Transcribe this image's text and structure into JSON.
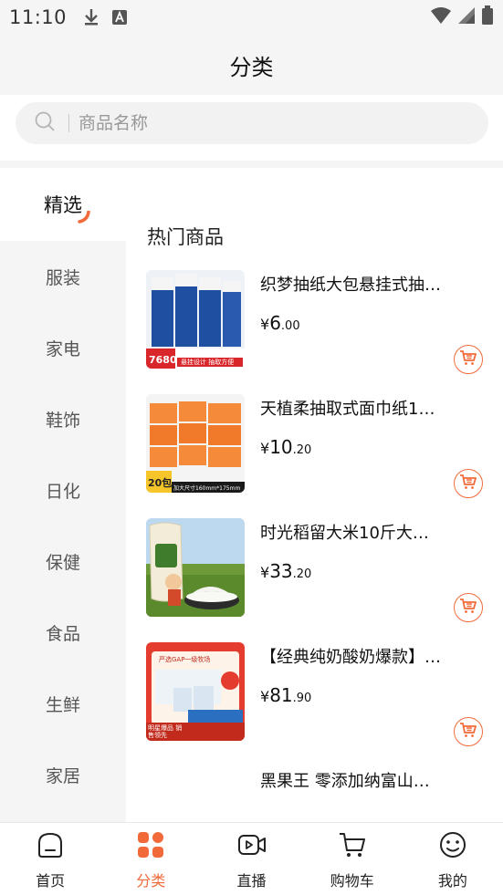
{
  "status_bar": {
    "time": "11:10"
  },
  "header": {
    "title": "分类"
  },
  "search": {
    "placeholder": "商品名称"
  },
  "sidebar": {
    "items": [
      {
        "label": "精选",
        "active": true
      },
      {
        "label": "服装"
      },
      {
        "label": "家电"
      },
      {
        "label": "鞋饰"
      },
      {
        "label": "日化"
      },
      {
        "label": "保健"
      },
      {
        "label": "食品"
      },
      {
        "label": "生鲜"
      },
      {
        "label": "家居"
      }
    ]
  },
  "main": {
    "section_title": "热门商品",
    "products": [
      {
        "name": "织梦抽纸大包悬挂式抽…",
        "symbol": "¥",
        "price_int": "6",
        "price_dec": ".00",
        "thumb_text": [
          "7680",
          "悬挂设计 抽取方便"
        ]
      },
      {
        "name": "天植柔抽取式面巾纸1…",
        "symbol": "¥",
        "price_int": "10",
        "price_dec": ".20",
        "thumb_text": [
          "20包",
          "加大尺寸160mm*175mm"
        ]
      },
      {
        "name": "时光稻留大米10斤大…",
        "symbol": "¥",
        "price_int": "33",
        "price_dec": ".20",
        "thumb_text": []
      },
      {
        "name": "【经典纯奶酸奶爆款】…",
        "symbol": "¥",
        "price_int": "81",
        "price_dec": ".90",
        "thumb_text": [
          "严选GAP一级牧场",
          "明星爆品 销售领先"
        ]
      },
      {
        "name": "黑果王 零添加纳富山…",
        "symbol": "",
        "price_int": "",
        "price_dec": "",
        "thumb_text": []
      }
    ]
  },
  "tabbar": {
    "tabs": [
      {
        "label": "首页",
        "icon": "home-icon"
      },
      {
        "label": "分类",
        "icon": "category-icon",
        "active": true
      },
      {
        "label": "直播",
        "icon": "live-video-icon"
      },
      {
        "label": "购物车",
        "icon": "shopping-cart-icon"
      },
      {
        "label": "我的",
        "icon": "profile-smile-icon"
      }
    ]
  },
  "colors": {
    "accent": "#f26a3a",
    "background": "#f5f5f5"
  }
}
